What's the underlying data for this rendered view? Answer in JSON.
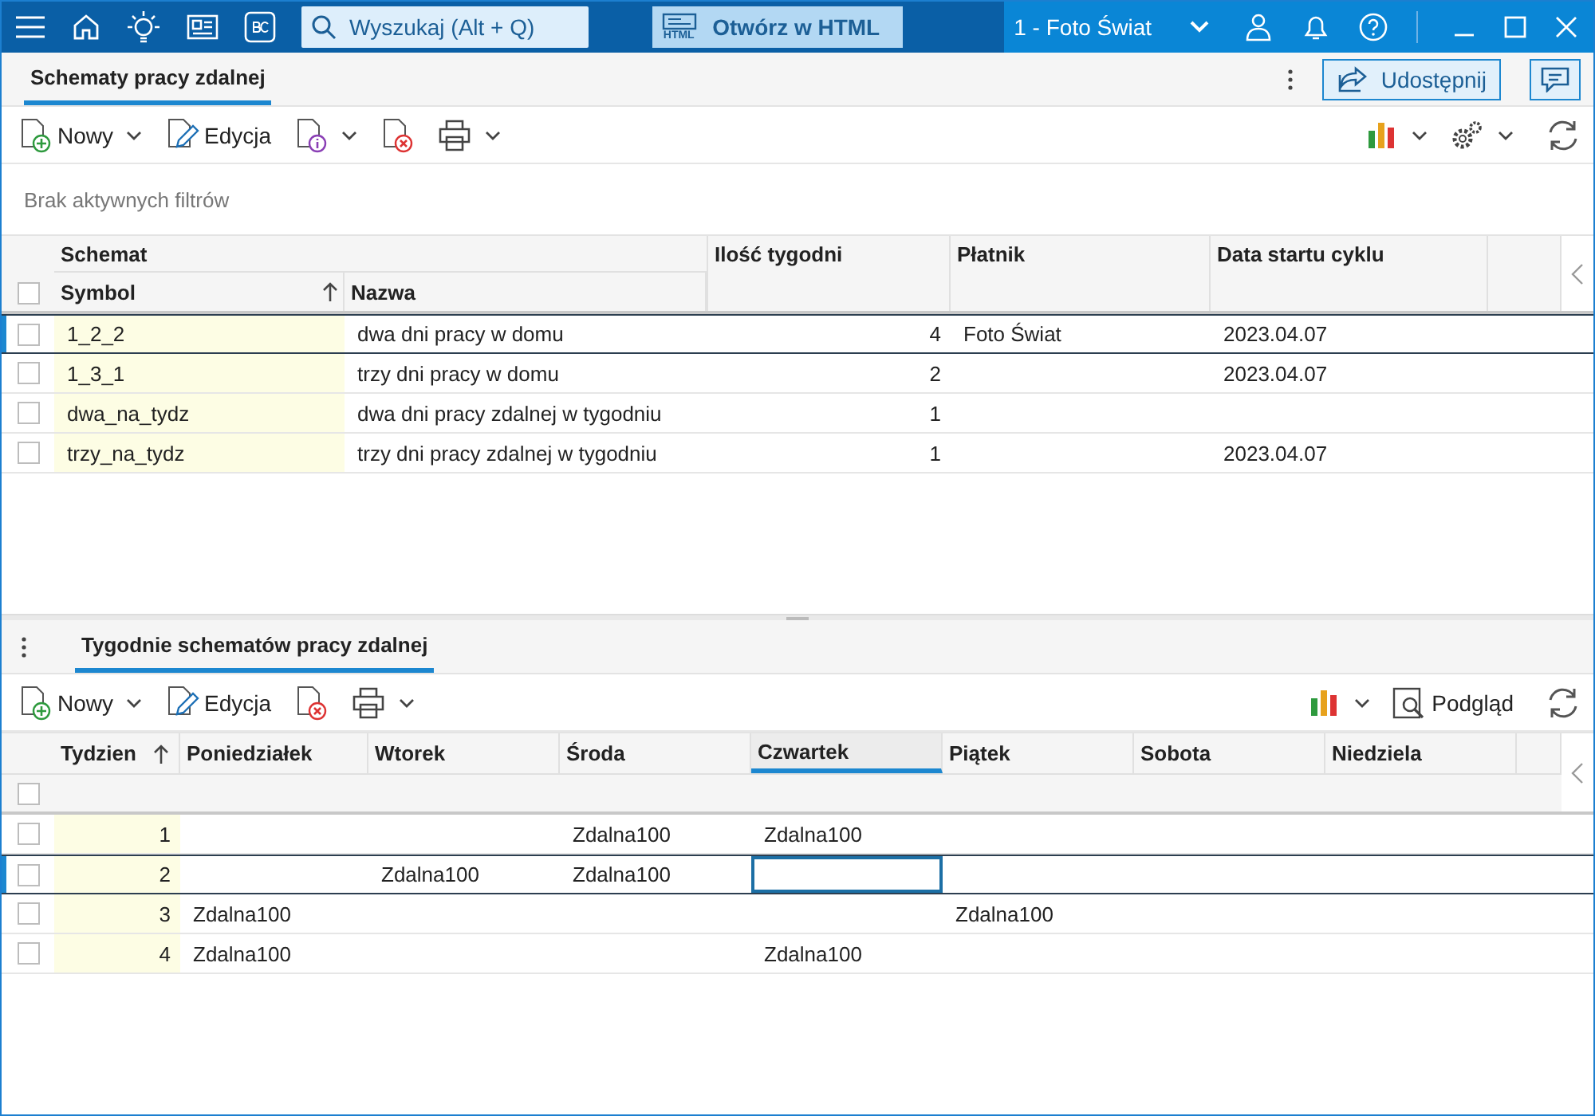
{
  "top_bar": {
    "search": {
      "placeholder": "Wyszukaj (Alt + Q)"
    },
    "html_button": {
      "icon_text": "HTML",
      "label": "Otwórz w HTML"
    },
    "company": "1 - Foto Świat"
  },
  "main": {
    "tab": {
      "label": "Schematy pracy zdalnej",
      "selected": true
    },
    "share_button": "Udostępnij",
    "toolbar": {
      "new": "Nowy",
      "edit": "Edycja"
    },
    "filter_status": "Brak aktywnych filtrów",
    "table": {
      "select_all_checked": false,
      "group_header": "Schemat",
      "columns": [
        {
          "label": "Symbol",
          "sorted": true
        },
        {
          "label": "Nazwa",
          "sorted": false
        },
        {
          "label": "Ilość tygodni",
          "sorted": false
        },
        {
          "label": "Płatnik",
          "sorted": false
        },
        {
          "label": "Data startu cyklu",
          "sorted": false
        }
      ],
      "rows": [
        {
          "checked": false,
          "current": true,
          "cells": [
            "1_2_2",
            "dwa dni pracy w domu",
            "4",
            "Foto Świat",
            "2023.04.07"
          ]
        },
        {
          "checked": false,
          "current": false,
          "cells": [
            "1_3_1",
            "trzy dni pracy w domu",
            "2",
            "",
            "2023.04.07"
          ]
        },
        {
          "checked": false,
          "current": false,
          "cells": [
            "dwa_na_tydz",
            "dwa dni pracy zdalnej w tygodniu",
            "1",
            "",
            ""
          ]
        },
        {
          "checked": false,
          "current": false,
          "cells": [
            "trzy_na_tydz",
            "trzy dni pracy zdalnej w tygodniu",
            "1",
            "",
            "2023.04.07"
          ]
        }
      ]
    }
  },
  "detail": {
    "tab": {
      "label": "Tygodnie schematów pracy zdalnej",
      "selected": true
    },
    "toolbar": {
      "new": "Nowy",
      "edit": "Edycja",
      "preview": "Podgląd"
    },
    "table": {
      "select_all_checked": false,
      "columns": [
        {
          "label": "Tydzien",
          "sorted": true,
          "active": false
        },
        {
          "label": "Poniedziałek",
          "sorted": false,
          "active": false
        },
        {
          "label": "Wtorek",
          "sorted": false,
          "active": false
        },
        {
          "label": "Środa",
          "sorted": false,
          "active": false
        },
        {
          "label": "Czwartek",
          "sorted": false,
          "active": true
        },
        {
          "label": "Piątek",
          "sorted": false,
          "active": false
        },
        {
          "label": "Sobota",
          "sorted": false,
          "active": false
        },
        {
          "label": "Niedziela",
          "sorted": false,
          "active": false
        }
      ],
      "rows": [
        {
          "checked": false,
          "current": false,
          "cells": [
            {
              "text": "1",
              "focused": false
            },
            {
              "text": "",
              "focused": false
            },
            {
              "text": "",
              "focused": false
            },
            {
              "text": "Zdalna100",
              "focused": false
            },
            {
              "text": "Zdalna100",
              "focused": false
            },
            {
              "text": "",
              "focused": false
            },
            {
              "text": "",
              "focused": false
            },
            {
              "text": "",
              "focused": false
            }
          ]
        },
        {
          "checked": false,
          "current": true,
          "cells": [
            {
              "text": "2",
              "focused": false
            },
            {
              "text": "",
              "focused": false
            },
            {
              "text": "Zdalna100",
              "focused": false
            },
            {
              "text": "Zdalna100",
              "focused": false
            },
            {
              "text": "",
              "focused": true
            },
            {
              "text": "",
              "focused": false
            },
            {
              "text": "",
              "focused": false
            },
            {
              "text": "",
              "focused": false
            }
          ]
        },
        {
          "checked": false,
          "current": false,
          "cells": [
            {
              "text": "3",
              "focused": false
            },
            {
              "text": "Zdalna100",
              "focused": false
            },
            {
              "text": "",
              "focused": false
            },
            {
              "text": "",
              "focused": false
            },
            {
              "text": "",
              "focused": false
            },
            {
              "text": "Zdalna100",
              "focused": false
            },
            {
              "text": "",
              "focused": false
            },
            {
              "text": "",
              "focused": false
            }
          ]
        },
        {
          "checked": false,
          "current": false,
          "cells": [
            {
              "text": "4",
              "focused": false
            },
            {
              "text": "Zdalna100",
              "focused": false
            },
            {
              "text": "",
              "focused": false
            },
            {
              "text": "",
              "focused": false
            },
            {
              "text": "Zdalna100",
              "focused": false
            },
            {
              "text": "",
              "focused": false
            },
            {
              "text": "",
              "focused": false
            },
            {
              "text": "",
              "focused": false
            }
          ]
        }
      ]
    }
  }
}
